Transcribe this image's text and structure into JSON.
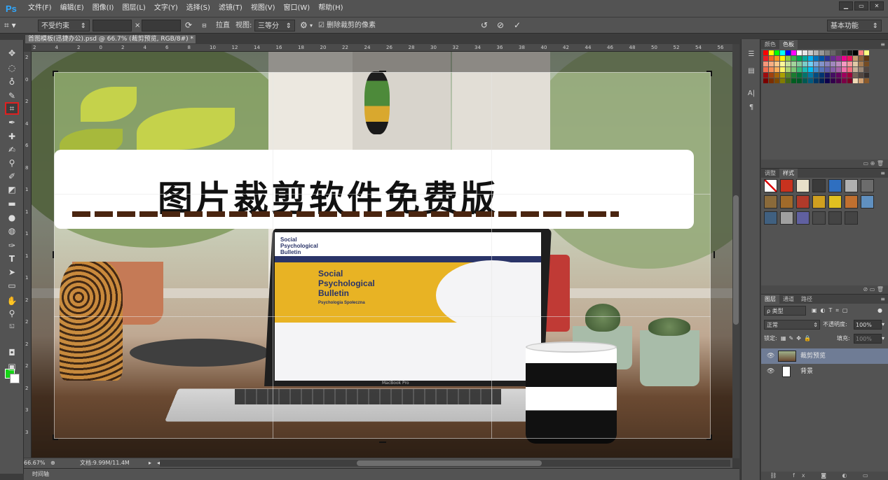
{
  "app": {
    "logo": "Ps"
  },
  "menu": [
    "文件(F)",
    "编辑(E)",
    "图像(I)",
    "图层(L)",
    "文字(Y)",
    "选择(S)",
    "滤镜(T)",
    "视图(V)",
    "窗口(W)",
    "帮助(H)"
  ],
  "window_controls": {
    "minimize": "▁",
    "restore": "▭",
    "close": "✕"
  },
  "options": {
    "ratio_select": "不受约束",
    "x_sep": "×",
    "straighten": "拉直",
    "view_label": "视图:",
    "view_select": "三等分",
    "delete_checkbox_label": "删除裁剪的像素",
    "workspace": "基本功能"
  },
  "document": {
    "tab_title": "首图模板(迅捷办公).psd @ 66.7% (裁剪预览, RGB/8#) *",
    "tab_close": "×",
    "banner_text": "图片裁剪软件免费版",
    "laptop_site_title": "Social Psychological Bulletin",
    "laptop_hero_title": "Social Psychological Bulletin",
    "laptop_hero_sub": "Psychologia Społeczna",
    "laptop_brand": "MacBook Pro"
  },
  "ruler_top": [
    "2",
    "4",
    "2",
    "0",
    "2",
    "4",
    "6",
    "8",
    "10",
    "12",
    "14",
    "16",
    "18",
    "20",
    "22",
    "24",
    "26",
    "28",
    "30",
    "32",
    "34",
    "36",
    "38",
    "40",
    "42",
    "44",
    "46",
    "48",
    "50",
    "52",
    "54",
    "56"
  ],
  "ruler_left": [
    "2",
    "0",
    "2",
    "4",
    "6",
    "8",
    "1",
    "1",
    "1",
    "1",
    "1",
    "2",
    "2",
    "2",
    "2",
    "2",
    "3",
    "3"
  ],
  "status": {
    "zoom": "66.67%",
    "doc_info": "文档:9.99M/11.4M"
  },
  "timeline_label": "时间轴",
  "panels": {
    "color_tabs": [
      "颜色",
      "色板"
    ],
    "color_active_index": 1,
    "styles_tabs": [
      "调整",
      "样式"
    ],
    "styles_active_index": 1,
    "layers_tabs": [
      "图层",
      "通道",
      "路径"
    ],
    "layers_active_index": 0,
    "layer_filter": "ρ 类型",
    "blend_mode": "正常",
    "opacity_label": "不透明度:",
    "opacity_value": "100%",
    "lock_label": "锁定:",
    "fill_label": "填充:",
    "fill_value": "100%",
    "layers": [
      {
        "name": "裁剪预览",
        "selected": true,
        "thumb": "image"
      },
      {
        "name": "背景",
        "selected": false,
        "thumb": "white"
      }
    ]
  },
  "colors": {
    "foreground": "#16d416",
    "background": "#ffffff",
    "active_tool_outline": "#e02020",
    "selected_layer": "#6f7c95"
  },
  "swatches": [
    "#ff0000",
    "#ffff00",
    "#00ff00",
    "#00ffff",
    "#0000ff",
    "#ff00ff",
    "#ffffff",
    "#e6e6e6",
    "#cccccc",
    "#b3b3b3",
    "#999999",
    "#808080",
    "#666666",
    "#4d4d4d",
    "#333333",
    "#1a1a1a",
    "#000000",
    "#ff8080",
    "#ffff80",
    "#ed1c24",
    "#f26522",
    "#f7941d",
    "#fff200",
    "#8dc63f",
    "#39b54a",
    "#00a651",
    "#00a99d",
    "#00aeef",
    "#0072bc",
    "#0054a6",
    "#2e3192",
    "#662d91",
    "#92278f",
    "#ec008c",
    "#ed145b",
    "#c69c6d",
    "#8c6239",
    "#603913",
    "#f69679",
    "#f9ad81",
    "#fdc689",
    "#fff799",
    "#c4df9b",
    "#a3d39c",
    "#82ca9c",
    "#7accc8",
    "#6dcff6",
    "#7da7d9",
    "#8393ca",
    "#8781bd",
    "#a187be",
    "#bd8cbf",
    "#f49ac1",
    "#f5989d",
    "#e0c9a6",
    "#a67c52",
    "#754c24",
    "#f26c4f",
    "#f68e55",
    "#fbaf5c",
    "#fff467",
    "#acd372",
    "#7cc576",
    "#3bb878",
    "#1abbb4",
    "#00bff3",
    "#438ccb",
    "#5574b9",
    "#605ca8",
    "#855fa8",
    "#a763a8",
    "#f06eaa",
    "#f26d7d",
    "#c7b299",
    "#998675",
    "#534741",
    "#9e0b0f",
    "#a0410d",
    "#a36209",
    "#aba000",
    "#598527",
    "#1a7b30",
    "#007236",
    "#00746b",
    "#0076a3",
    "#004b80",
    "#003471",
    "#1b1464",
    "#440e62",
    "#630460",
    "#9e005d",
    "#9e0039",
    "#736357",
    "#534741",
    "#362f2d",
    "#790000",
    "#7b2e00",
    "#7d4900",
    "#827b00",
    "#406618",
    "#005e20",
    "#005826",
    "#005952",
    "#005b7f",
    "#003663",
    "#002157",
    "#0d004c",
    "#32004b",
    "#4b0049",
    "#7b0046",
    "#7a0026",
    "#f0d9b5",
    "#d4a373",
    "#8b5a2b"
  ],
  "style_cells": [
    "none",
    "#c8321e",
    "#e8e0c8",
    "#3a3a3a",
    "#2f6fc0",
    "#b0b0b0",
    "#6c6c6c",
    "#8a6a3a",
    "#a06a2a",
    "#b03a2a",
    "#d0a020",
    "#e0c020",
    "#c07030",
    "#6090c0",
    "#406080",
    "#a0a0a0",
    "#6060a0",
    "#4a4a4a",
    "#444444",
    "#444444"
  ]
}
